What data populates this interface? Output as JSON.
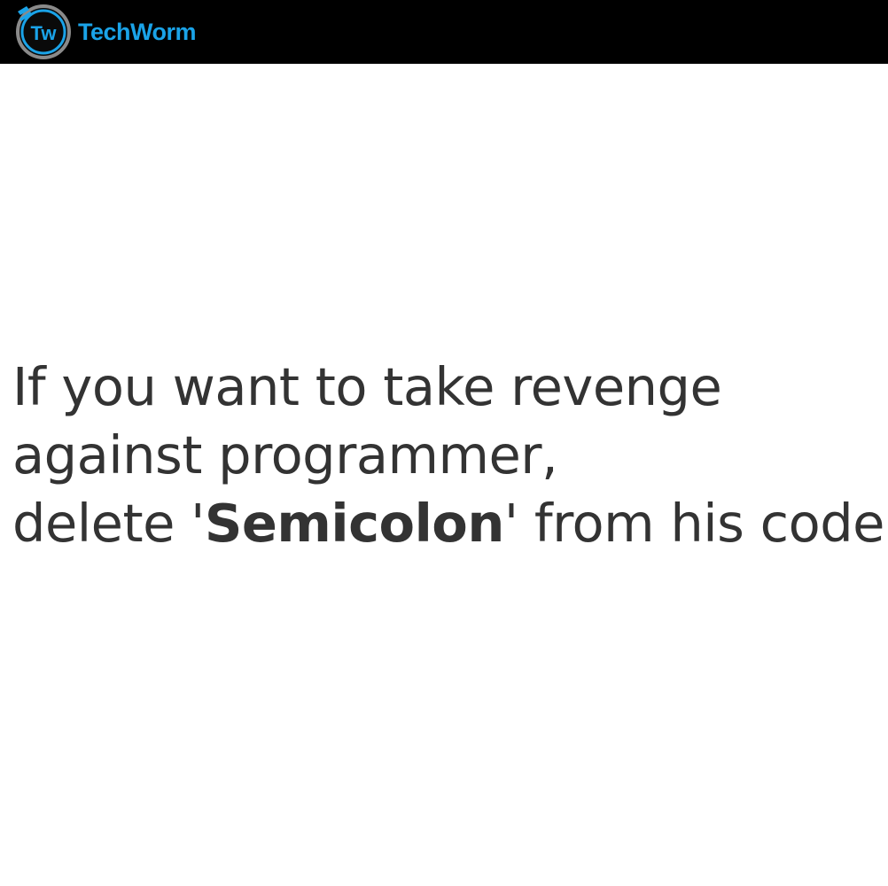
{
  "header": {
    "logo_monogram": "Tw",
    "brand_name": "TechWorm",
    "brand_color": "#1aa3e8",
    "background_color": "#000000"
  },
  "quote": {
    "text_color": "#333333",
    "line1": "If you want to take revenge",
    "line2": "against programmer,",
    "line3_prefix": "delete '",
    "line3_emphasis": "Semicolon",
    "line3_suffix": "' from his code."
  }
}
